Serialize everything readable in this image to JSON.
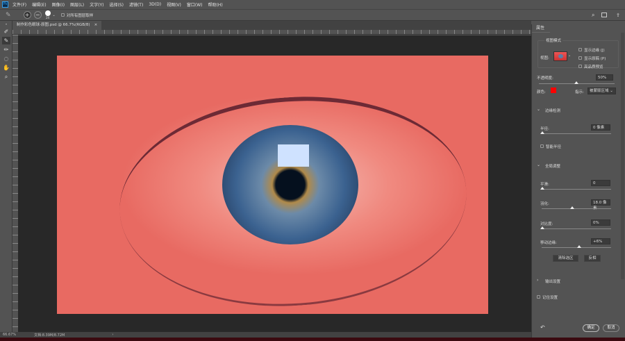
{
  "app": {
    "logo": "Ps"
  },
  "menu": [
    "文件(F)",
    "编辑(E)",
    "图像(I)",
    "图层(L)",
    "文字(Y)",
    "选择(S)",
    "滤镜(T)",
    "3D(D)",
    "视图(V)",
    "窗口(W)",
    "帮助(H)"
  ],
  "options": {
    "brush_size": "24",
    "sample_all_layers": "对所有图层取样"
  },
  "document": {
    "tab_title": "制作彩色眼球-原图.psd @ 66.7%(RGB/8)",
    "close": "×"
  },
  "status": {
    "zoom": "66.67%",
    "doc": "文档:8.39M/8.72M",
    "arrow": "›"
  },
  "panel": {
    "tab": "属性",
    "view_mode": {
      "title": "视图模式",
      "view_label": "视图:",
      "show_edge": "显示边缘 (J)",
      "show_original": "显示原稿 (P)",
      "hq_preview": "高品质预览"
    },
    "opacity": {
      "label": "不透明度:",
      "value": "50%",
      "fraction": 0.5
    },
    "color": {
      "label": "颜色:",
      "value": "#ff0000"
    },
    "indicates": {
      "label": "指示:",
      "value": "被蒙版区域"
    },
    "edge_detection": {
      "title": "边缘检测",
      "radius_label": "半径:",
      "radius_value": "0 像素",
      "smart_radius": "智能半径"
    },
    "global": {
      "title": "全局调整",
      "smooth_label": "平滑:",
      "smooth_value": "0",
      "feather_label": "羽化:",
      "feather_value": "18.0 像素",
      "contrast_label": "对比度:",
      "contrast_value": "0%",
      "shift_label": "移动边缘:",
      "shift_value": "+6%",
      "clear": "清除选区",
      "invert": "反相"
    },
    "output": {
      "title": "输出设置"
    },
    "remember": "记住设置",
    "ok": "确定",
    "cancel": "取消"
  }
}
